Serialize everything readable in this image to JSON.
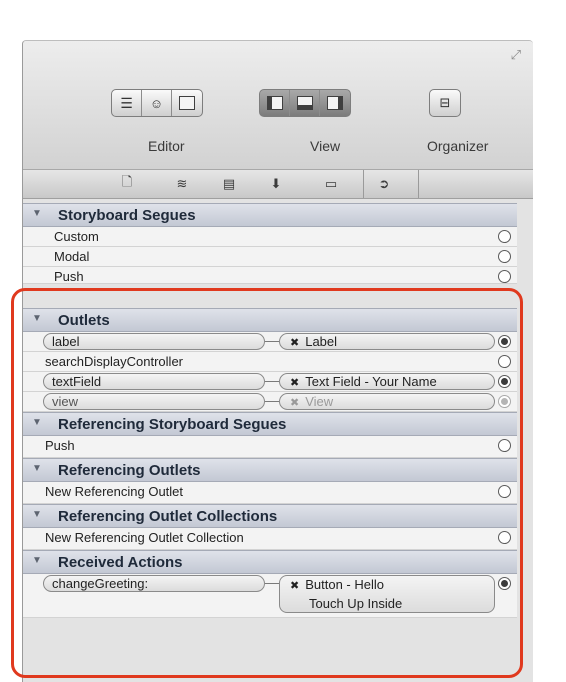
{
  "toolbar": {
    "editor_label": "Editor",
    "view_label": "View",
    "organizer_label": "Organizer",
    "editor_icons": [
      "standard-editor-icon",
      "assistant-editor-icon",
      "version-editor-icon"
    ],
    "view_icons": [
      "navigator-icon",
      "debug-area-icon",
      "utilities-icon"
    ],
    "organizer_icon": "organizer-icon"
  },
  "inspector_tabs": [
    "file-inspector-icon",
    "quick-help-icon",
    "identity-inspector-icon",
    "attributes-inspector-icon",
    "size-inspector-icon",
    "connections-inspector-icon"
  ],
  "sections": {
    "storyboard_segues": {
      "title": "Storyboard Segues",
      "items": [
        "Custom",
        "Modal",
        "Push"
      ]
    },
    "outlets": {
      "title": "Outlets",
      "items": [
        {
          "name": "label",
          "target": "Label",
          "connected": true
        },
        {
          "name": "searchDisplayController",
          "target": "",
          "connected": false
        },
        {
          "name": "textField",
          "target": "Text Field - Your Name",
          "connected": true
        },
        {
          "name": "view",
          "target": "View",
          "connected": true
        }
      ]
    },
    "referencing_segues": {
      "title": "Referencing Storyboard Segues",
      "items": [
        "Push"
      ]
    },
    "referencing_outlets": {
      "title": "Referencing Outlets",
      "items": [
        "New Referencing Outlet"
      ]
    },
    "referencing_collections": {
      "title": "Referencing Outlet Collections",
      "items": [
        "New Referencing Outlet Collection"
      ]
    },
    "received_actions": {
      "title": "Received Actions",
      "items": [
        {
          "name": "changeGreeting:",
          "target_line1": "Button - Hello",
          "target_line2": "Touch Up Inside"
        }
      ]
    }
  },
  "colors": {
    "highlight": "#e0391e",
    "section_header": "#c3c8d4"
  }
}
